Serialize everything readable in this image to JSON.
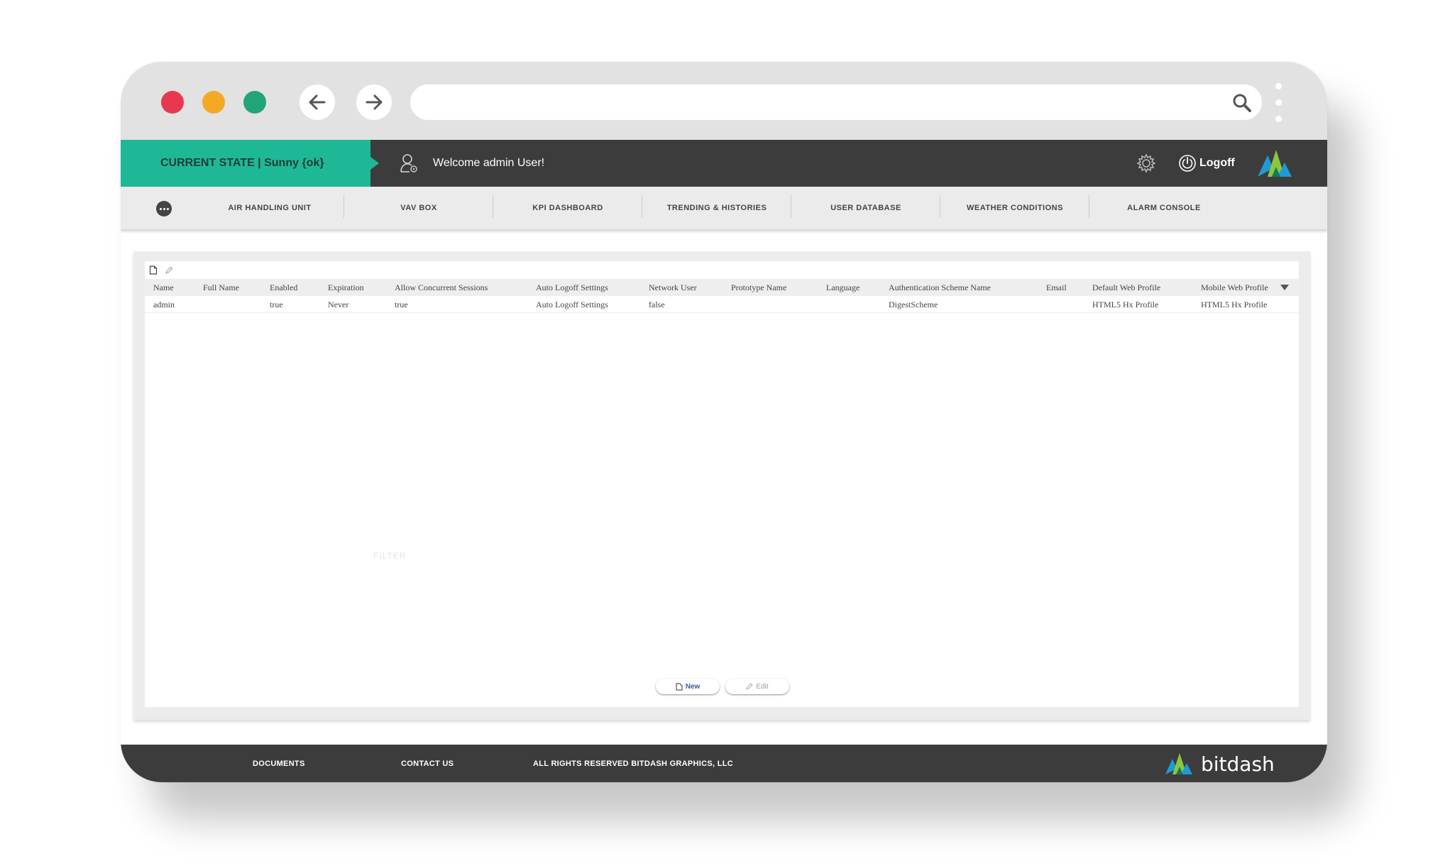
{
  "header": {
    "state_label": "CURRENT STATE | Sunny {ok}",
    "welcome": "Welcome admin  User!",
    "logoff": "Logoff"
  },
  "nav": {
    "items": [
      "AIR HANDLING UNIT",
      "VAV BOX",
      "KPI DASHBOARD",
      "TRENDING & HISTORIES",
      "USER DATABASE",
      "WEATHER CONDITIONS",
      "ALARM CONSOLE"
    ]
  },
  "table": {
    "columns": [
      "Name",
      "Full Name",
      "Enabled",
      "Expiration",
      "Allow Concurrent Sessions",
      "Auto Logoff Settings",
      "Network User",
      "Prototype Name",
      "Language",
      "Authentication Scheme Name",
      "Email",
      "Default Web Profile",
      "Mobile Web Profile"
    ],
    "rows": [
      [
        "admin",
        "",
        "true",
        "Never",
        "true",
        "Auto Logoff Settings",
        "false",
        "",
        "",
        "DigestScheme",
        "",
        "HTML5 Hx Profile",
        "HTML5 Hx Profile"
      ]
    ]
  },
  "panel": {
    "filter_label": "FILTER",
    "new_label": "New",
    "edit_label": "Edit"
  },
  "footer": {
    "documents": "DOCUMENTS",
    "contact": "CONTACT US",
    "rights": "ALL RIGHTS RESERVED BITDASH GRAPHICS, LLC",
    "brand": "bitdash"
  },
  "colors": {
    "state_bg": "#1fb896",
    "header_bg": "#3c3c3c",
    "close_dot": "#e8384f",
    "minimize_dot": "#f4a925",
    "maximize_dot": "#22a479"
  }
}
